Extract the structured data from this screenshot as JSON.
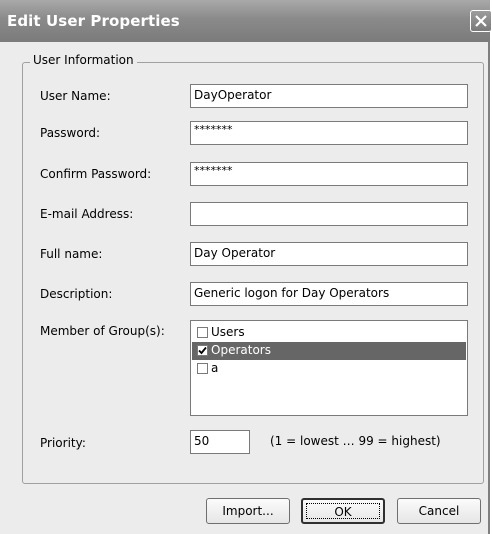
{
  "window": {
    "title": "Edit User Properties"
  },
  "group": {
    "legend": "User Information"
  },
  "fields": {
    "user_name": {
      "label": "User Name:",
      "value": "DayOperator"
    },
    "password": {
      "label": "Password:",
      "value": "*******"
    },
    "confirm_password": {
      "label": "Confirm Password:",
      "value": "*******"
    },
    "email": {
      "label": "E-mail Address:",
      "value": ""
    },
    "full_name": {
      "label": "Full name:",
      "value": "Day Operator"
    },
    "description": {
      "label": "Description:",
      "value": "Generic logon for Day Operators"
    }
  },
  "groups": {
    "label": "Member of Group(s):",
    "items": [
      {
        "label": "Users",
        "checked": false,
        "selected": false
      },
      {
        "label": "Operators",
        "checked": true,
        "selected": true
      },
      {
        "label": "a",
        "checked": false,
        "selected": false
      }
    ]
  },
  "priority": {
    "label": "Priority:",
    "value": "50",
    "hint": "(1 = lowest … 99 = highest)"
  },
  "buttons": {
    "import": "Import...",
    "ok": "OK",
    "cancel": "Cancel"
  },
  "colors": {
    "title_bar": "#8a8a8a",
    "selection": "#666666",
    "dialog_bg": "#ececec"
  },
  "icons": {
    "close": "close-icon",
    "checkmark": "checkmark-icon"
  }
}
